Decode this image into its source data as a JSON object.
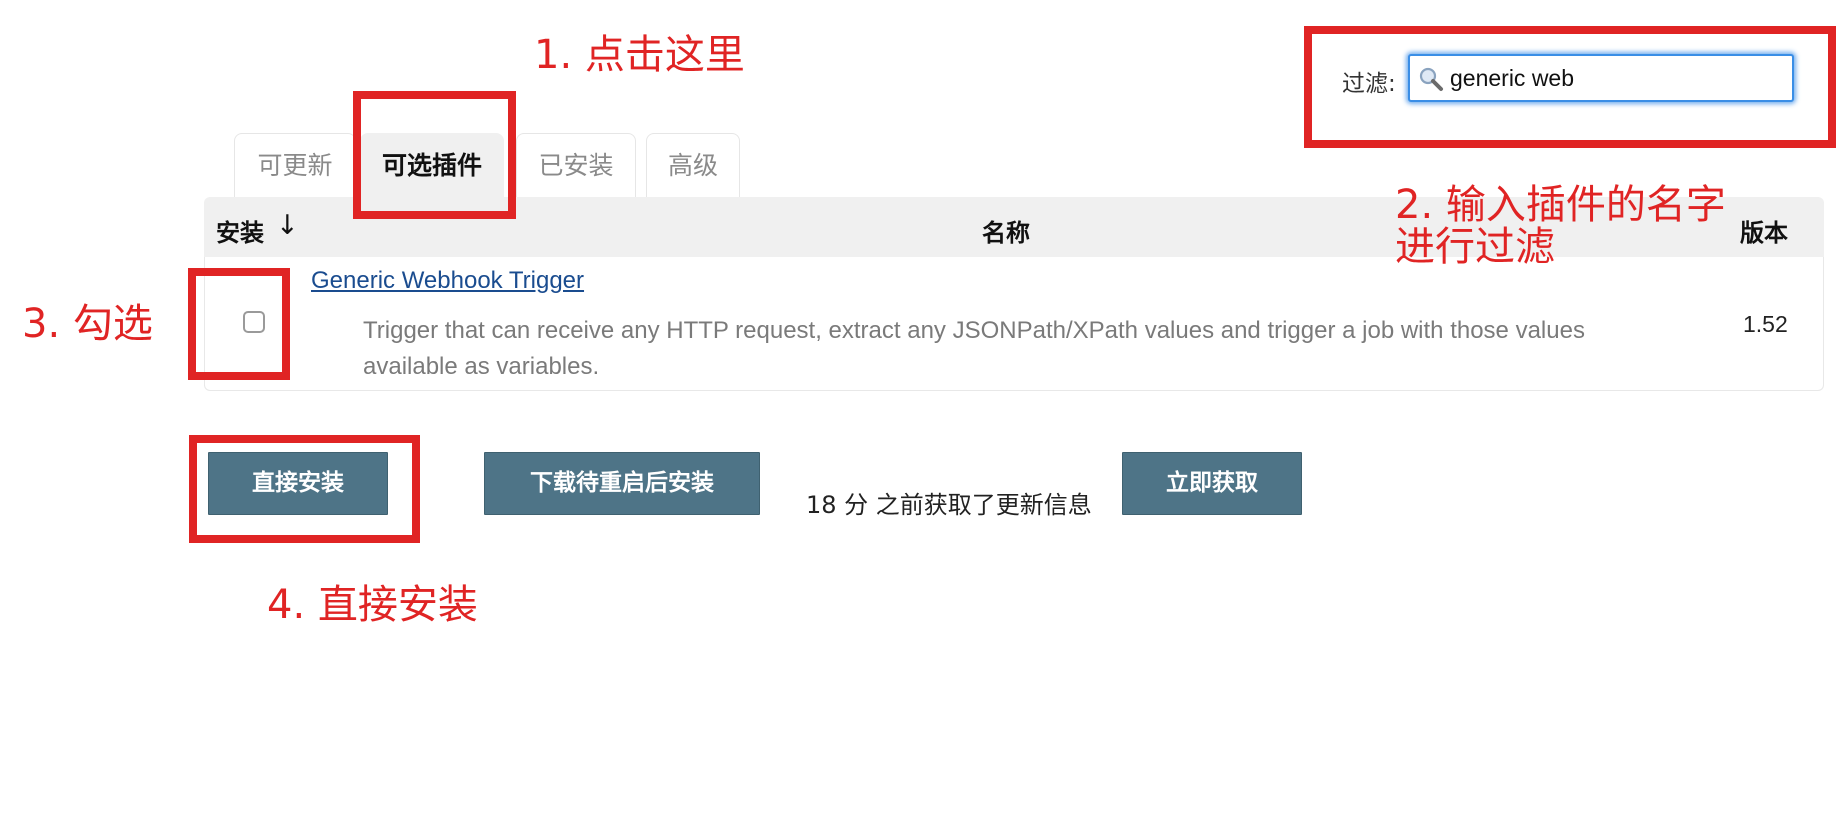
{
  "filter": {
    "label": "过滤:",
    "value": "generic web"
  },
  "tabs": [
    {
      "label": "可更新",
      "active": false
    },
    {
      "label": "可选插件",
      "active": true
    },
    {
      "label": "已安装",
      "active": false
    },
    {
      "label": "高级",
      "active": false
    }
  ],
  "table": {
    "headers": {
      "install": "安装",
      "sort_indicator": "↓",
      "name": "名称",
      "version": "版本"
    },
    "rows": [
      {
        "name": "Generic Webhook Trigger",
        "description_line1": "Trigger that can receive any HTTP request, extract any JSONPath/XPath values and trigger a job with those values",
        "description_line2": "available as variables.",
        "version": "1.52",
        "checked": false
      }
    ]
  },
  "actions": {
    "install_now": "直接安装",
    "download_restart": "下载待重启后安装",
    "status": "18 分 之前获取了更新信息",
    "check_now": "立即获取"
  },
  "annotations": {
    "step1": "1. 点击这里",
    "step2_line1": "2. 输入插件的名字",
    "step2_line2": "进行过滤",
    "step3": "3. 勾选",
    "step4": "4. 直接安装",
    "color": "#e02424"
  },
  "colors": {
    "button": "#4e7487",
    "link": "#1a4c8f",
    "focus": "#3a8ee6"
  }
}
